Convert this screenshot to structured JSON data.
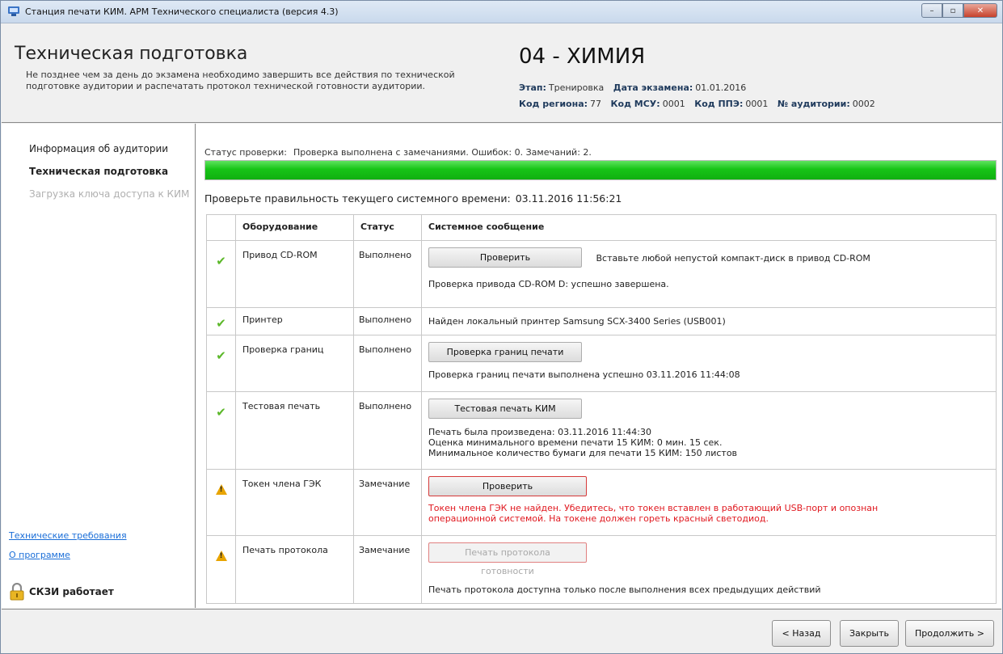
{
  "window": {
    "title": "Станция печати КИМ. АРМ Технического специалиста (версия 4.3)",
    "controls": {
      "minimize": "–",
      "maximize": "▫",
      "close": "✕"
    }
  },
  "header": {
    "title": "Техническая подготовка",
    "description": "Не позднее чем за день до экзамена необходимо завершить все действия по технической подготовке аудитории и распечатать протокол технической готовности аудитории.",
    "subject": "04 - ХИМИЯ",
    "stage_label": "Этап:",
    "stage_value": "Тренировка",
    "date_label": "Дата экзамена:",
    "date_value": "01.01.2016",
    "region_label": "Код региона:",
    "region_value": "77",
    "msu_label": "Код МСУ:",
    "msu_value": "0001",
    "ppe_label": "Код ППЭ:",
    "ppe_value": "0001",
    "room_label": "№ аудитории:",
    "room_value": "0002"
  },
  "sidebar": {
    "items": [
      {
        "label": "Информация об аудитории",
        "state": "normal"
      },
      {
        "label": "Техническая подготовка",
        "state": "active"
      },
      {
        "label": "Загрузка ключа доступа к КИМ",
        "state": "disabled"
      }
    ],
    "links": {
      "tech_requirements": "Технические требования",
      "about": "О программе"
    },
    "skzi_status": "СКЗИ работает"
  },
  "main": {
    "status_label": "Статус проверки:",
    "status_text": "Проверка выполнена с замечаниями. Ошибок: 0. Замечаний: 2.",
    "progress_percent": 100,
    "progress_color": "#17c417",
    "time_prompt": "Проверьте правильность текущего системного времени:",
    "time_value": "03.11.2016 11:56:21",
    "table": {
      "headers": {
        "equipment": "Оборудование",
        "status": "Статус",
        "message": "Системное сообщение"
      },
      "rows": {
        "cdrom": {
          "icon": "check-icon",
          "equipment": "Привод CD-ROM",
          "status": "Выполнено",
          "button": "Проверить",
          "hint": "Вставьте любой непустой компакт-диск в привод CD-ROM",
          "message": "Проверка привода CD-ROM D: успешно завершена."
        },
        "printer": {
          "icon": "check-icon",
          "equipment": "Принтер",
          "status": "Выполнено",
          "message": "Найден локальный принтер Samsung SCX-3400 Series (USB001)"
        },
        "borders": {
          "icon": "check-icon",
          "equipment": "Проверка границ",
          "status": "Выполнено",
          "button": "Проверка границ печати",
          "message": "Проверка границ печати выполнена успешно 03.11.2016 11:44:08"
        },
        "testprint": {
          "icon": "check-icon",
          "equipment": "Тестовая печать",
          "status": "Выполнено",
          "button": "Тестовая печать КИМ",
          "message_line1": "Печать была произведена: 03.11.2016 11:44:30",
          "message_line2": "Оценка минимального времени печати 15 КИМ: 0 мин. 15 сек.",
          "message_line3": "Минимальное количество бумаги для печати 15 КИМ: 150 листов"
        },
        "token": {
          "icon": "warning-icon",
          "equipment": "Токен члена ГЭК",
          "status": "Замечание",
          "button": "Проверить",
          "error_line1": "Токен члена ГЭК не найден. Убедитесь, что токен вставлен в работающий USB-порт и опознан",
          "error_line2": "операционной системой. На токене должен гореть красный светодиод."
        },
        "protocol": {
          "icon": "warning-icon",
          "equipment": "Печать протокола",
          "status": "Замечание",
          "button": "Печать протокола готовности",
          "message": "Печать протокола доступна только после выполнения всех предыдущих действий"
        }
      }
    }
  },
  "footer": {
    "back": "< Назад",
    "close": "Закрыть",
    "next": "Продолжить >"
  },
  "colors": {
    "error_text": "#e0181f",
    "link": "#1a6ed8",
    "success_check": "#5cb82a",
    "warning": "#e8a400"
  }
}
